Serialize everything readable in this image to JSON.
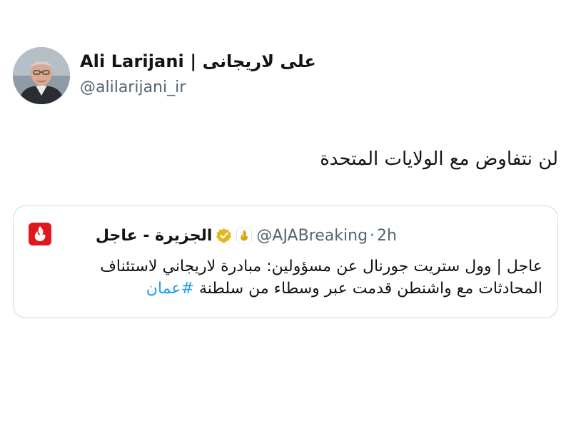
{
  "author": {
    "name": "Ali Larijani | علی لاریجانی",
    "handle": "@alilarijani_ir"
  },
  "tweet": {
    "text": "لن نتفاوض مع الولايات المتحدة"
  },
  "quoted": {
    "name": "الجزيرة - عاجل",
    "handle": "@AJABreaking",
    "separator": "·",
    "time": "2h",
    "line1": "عاجل | وول ستريت جورنال عن مسؤولين: مبادرة لاريجاني لاستئناف",
    "line2_text": "المحادثات مع واشنطن قدمت عبر وسطاء من سلطنة",
    "hashtag": "#عمان"
  },
  "colors": {
    "text": "#0f1419",
    "secondary": "#536471",
    "link": "#1d9bf0",
    "card_border": "#cfd9de",
    "aja_red": "#e0181e",
    "verified_gold": "#e2b719"
  },
  "icons": {
    "verified": "verified-gold-badge-icon",
    "source_logo": "al-jazeera-logo-icon"
  }
}
